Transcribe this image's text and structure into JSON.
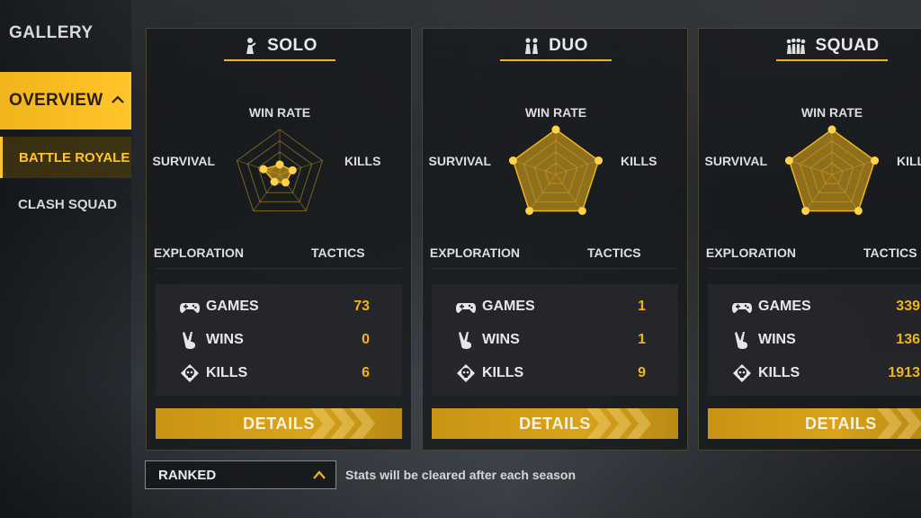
{
  "sidebar": {
    "gallery": "GALLERY",
    "overview": "OVERVIEW",
    "items": [
      {
        "label": "BATTLE ROYALE",
        "active": true
      },
      {
        "label": "CLASH SQUAD",
        "active": false
      }
    ]
  },
  "radar_labels": {
    "win_rate": "WIN RATE",
    "kills": "KILLS",
    "tactics": "TACTICS",
    "exploration": "EXPLORATION",
    "survival": "SURVIVAL"
  },
  "stat_labels": {
    "games": "GAMES",
    "wins": "WINS",
    "kills": "KILLS"
  },
  "modes": [
    {
      "title": "SOLO",
      "icon": "solo-player-icon",
      "radar": {
        "win_rate": 0.22,
        "kills": 0.3,
        "tactics": 0.22,
        "exploration": 0.2,
        "survival": 0.38
      },
      "stats": {
        "games": "73",
        "wins": "0",
        "kills": "6"
      },
      "details": "DETAILS"
    },
    {
      "title": "DUO",
      "icon": "duo-players-icon",
      "radar": {
        "win_rate": 1.0,
        "kills": 1.0,
        "tactics": 1.0,
        "exploration": 1.0,
        "survival": 1.0
      },
      "stats": {
        "games": "1",
        "wins": "1",
        "kills": "9"
      },
      "details": "DETAILS"
    },
    {
      "title": "SQUAD",
      "icon": "squad-players-icon",
      "radar": {
        "win_rate": 1.0,
        "kills": 1.0,
        "tactics": 1.0,
        "exploration": 1.0,
        "survival": 1.0
      },
      "stats": {
        "games": "339",
        "wins": "136",
        "kills": "1913"
      },
      "details": "DETAILS"
    }
  ],
  "footer": {
    "dropdown": "RANKED",
    "note": "Stats will be cleared after each season"
  },
  "colors": {
    "accent": "#f0b51c",
    "panel": "#16181b",
    "text": "#e6e6e6"
  }
}
